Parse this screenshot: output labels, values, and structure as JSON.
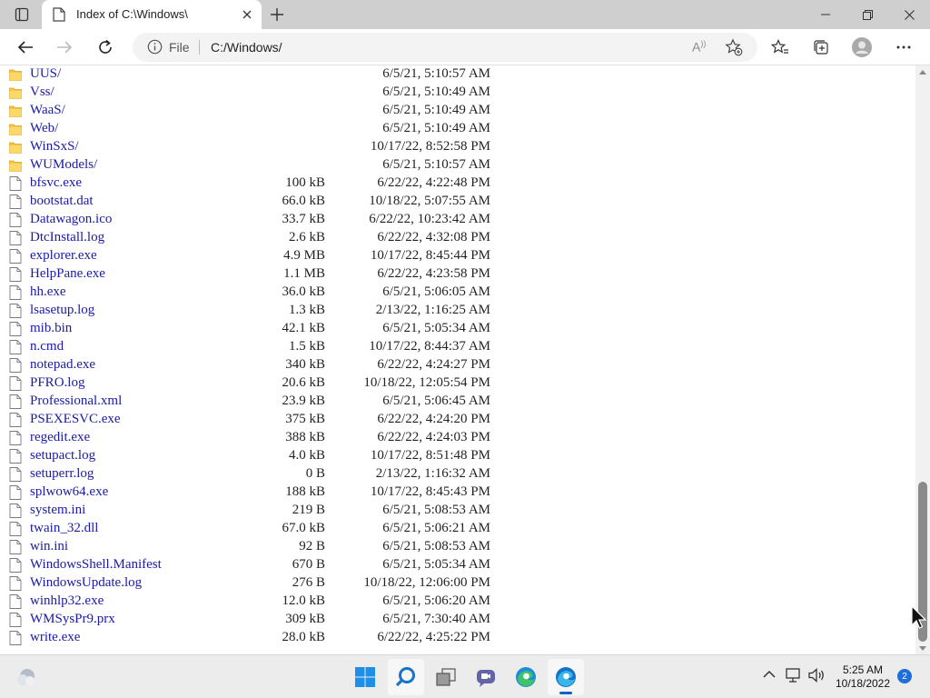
{
  "tab": {
    "title": "Index of C:\\Windows\\"
  },
  "address_bar": {
    "scheme": "File",
    "url": "C:/Windows/"
  },
  "files": [
    {
      "type": "folder",
      "name": "UUS/",
      "size": "",
      "date": "6/5/21, 5:10:57 AM"
    },
    {
      "type": "folder",
      "name": "Vss/",
      "size": "",
      "date": "6/5/21, 5:10:49 AM"
    },
    {
      "type": "folder",
      "name": "WaaS/",
      "size": "",
      "date": "6/5/21, 5:10:49 AM"
    },
    {
      "type": "folder",
      "name": "Web/",
      "size": "",
      "date": "6/5/21, 5:10:49 AM"
    },
    {
      "type": "folder",
      "name": "WinSxS/",
      "size": "",
      "date": "10/17/22, 8:52:58 PM"
    },
    {
      "type": "folder",
      "name": "WUModels/",
      "size": "",
      "date": "6/5/21, 5:10:57 AM"
    },
    {
      "type": "file",
      "name": "bfsvc.exe",
      "size": "100 kB",
      "date": "6/22/22, 4:22:48 PM"
    },
    {
      "type": "file",
      "name": "bootstat.dat",
      "size": "66.0 kB",
      "date": "10/18/22, 5:07:55 AM"
    },
    {
      "type": "file",
      "name": "Datawagon.ico",
      "size": "33.7 kB",
      "date": "6/22/22, 10:23:42 AM"
    },
    {
      "type": "file",
      "name": "DtcInstall.log",
      "size": "2.6 kB",
      "date": "6/22/22, 4:32:08 PM"
    },
    {
      "type": "file",
      "name": "explorer.exe",
      "size": "4.9 MB",
      "date": "10/17/22, 8:45:44 PM"
    },
    {
      "type": "file",
      "name": "HelpPane.exe",
      "size": "1.1 MB",
      "date": "6/22/22, 4:23:58 PM"
    },
    {
      "type": "file",
      "name": "hh.exe",
      "size": "36.0 kB",
      "date": "6/5/21, 5:06:05 AM"
    },
    {
      "type": "file",
      "name": "lsasetup.log",
      "size": "1.3 kB",
      "date": "2/13/22, 1:16:25 AM"
    },
    {
      "type": "file",
      "name": "mib.bin",
      "size": "42.1 kB",
      "date": "6/5/21, 5:05:34 AM"
    },
    {
      "type": "file",
      "name": "n.cmd",
      "size": "1.5 kB",
      "date": "10/17/22, 8:44:37 AM"
    },
    {
      "type": "file",
      "name": "notepad.exe",
      "size": "340 kB",
      "date": "6/22/22, 4:24:27 PM"
    },
    {
      "type": "file",
      "name": "PFRO.log",
      "size": "20.6 kB",
      "date": "10/18/22, 12:05:54 PM"
    },
    {
      "type": "file",
      "name": "Professional.xml",
      "size": "23.9 kB",
      "date": "6/5/21, 5:06:45 AM"
    },
    {
      "type": "file",
      "name": "PSEXESVC.exe",
      "size": "375 kB",
      "date": "6/22/22, 4:24:20 PM"
    },
    {
      "type": "file",
      "name": "regedit.exe",
      "size": "388 kB",
      "date": "6/22/22, 4:24:03 PM"
    },
    {
      "type": "file",
      "name": "setupact.log",
      "size": "4.0 kB",
      "date": "10/17/22, 8:51:48 PM"
    },
    {
      "type": "file",
      "name": "setuperr.log",
      "size": "0 B",
      "date": "2/13/22, 1:16:32 AM"
    },
    {
      "type": "file",
      "name": "splwow64.exe",
      "size": "188 kB",
      "date": "10/17/22, 8:45:43 PM"
    },
    {
      "type": "file",
      "name": "system.ini",
      "size": "219 B",
      "date": "6/5/21, 5:08:53 AM"
    },
    {
      "type": "file",
      "name": "twain_32.dll",
      "size": "67.0 kB",
      "date": "6/5/21, 5:06:21 AM"
    },
    {
      "type": "file",
      "name": "win.ini",
      "size": "92 B",
      "date": "6/5/21, 5:08:53 AM"
    },
    {
      "type": "file",
      "name": "WindowsShell.Manifest",
      "size": "670 B",
      "date": "6/5/21, 5:05:34 AM"
    },
    {
      "type": "file",
      "name": "WindowsUpdate.log",
      "size": "276 B",
      "date": "10/18/22, 12:06:00 PM"
    },
    {
      "type": "file",
      "name": "winhlp32.exe",
      "size": "12.0 kB",
      "date": "6/5/21, 5:06:20 AM"
    },
    {
      "type": "file",
      "name": "WMSysPr9.prx",
      "size": "309 kB",
      "date": "6/5/21, 7:30:40 AM"
    },
    {
      "type": "file",
      "name": "write.exe",
      "size": "28.0 kB",
      "date": "6/22/22, 4:25:22 PM"
    }
  ],
  "taskbar": {
    "apps": [
      "widgets-icon",
      "start-icon",
      "search-icon",
      "task-view-icon",
      "teams-chat-icon",
      "edge-icon",
      "edge-dev-icon"
    ],
    "clock_time": "5:25 AM",
    "clock_date": "10/18/2022",
    "notification_count": "2"
  },
  "colors": {
    "link": "#1a1aa6",
    "folder": "#f6c646",
    "accent": "#0a62c9",
    "taskbar": "#ececec",
    "tabbar": "#cfcfcf"
  }
}
